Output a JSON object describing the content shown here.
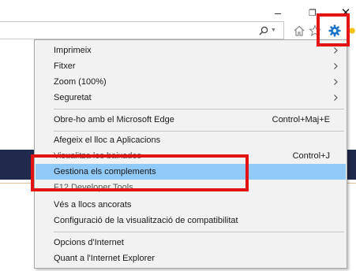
{
  "window": {
    "minimize_glyph": "–",
    "restore_glyph": "❐",
    "close_glyph": "✕"
  },
  "toolbar": {
    "search_icon": "search-icon",
    "home_icon": "home-icon",
    "favorites_icon": "star-icon",
    "tools_icon": "gear-icon",
    "tools_color": "#1a73c8"
  },
  "menu": {
    "items": [
      {
        "label": "Imprimeix",
        "shortcut": "",
        "submenu": true
      },
      {
        "label": "Fitxer",
        "shortcut": "",
        "submenu": true
      },
      {
        "label": "Zoom (100%)",
        "shortcut": "",
        "submenu": true
      },
      {
        "label": "Seguretat",
        "shortcut": "",
        "submenu": true
      },
      {
        "label": "Obre-ho amb el Microsoft Edge",
        "shortcut": "Control+Maj+E",
        "submenu": false
      },
      {
        "label": "Afegeix el lloc a Aplicacions",
        "shortcut": "",
        "submenu": false
      },
      {
        "label": "Visualitza les baixades",
        "shortcut": "Control+J",
        "submenu": false
      },
      {
        "label": "Gestiona els complements",
        "shortcut": "",
        "submenu": false,
        "highlighted": true
      },
      {
        "label": "F12 Developer Tools",
        "shortcut": "",
        "submenu": false
      },
      {
        "label": "Vés a llocs ancorats",
        "shortcut": "",
        "submenu": false
      },
      {
        "label": "Configuració de la visualització de compatibilitat",
        "shortcut": "",
        "submenu": false
      },
      {
        "label": "Opcions d'Internet",
        "shortcut": "",
        "submenu": false
      },
      {
        "label": "Quant a l'Internet Explorer",
        "shortcut": "",
        "submenu": false
      }
    ]
  },
  "colors": {
    "highlight": "#91c9f7",
    "annotation_red": "#e41313",
    "page_band": "#1f2a4c"
  }
}
